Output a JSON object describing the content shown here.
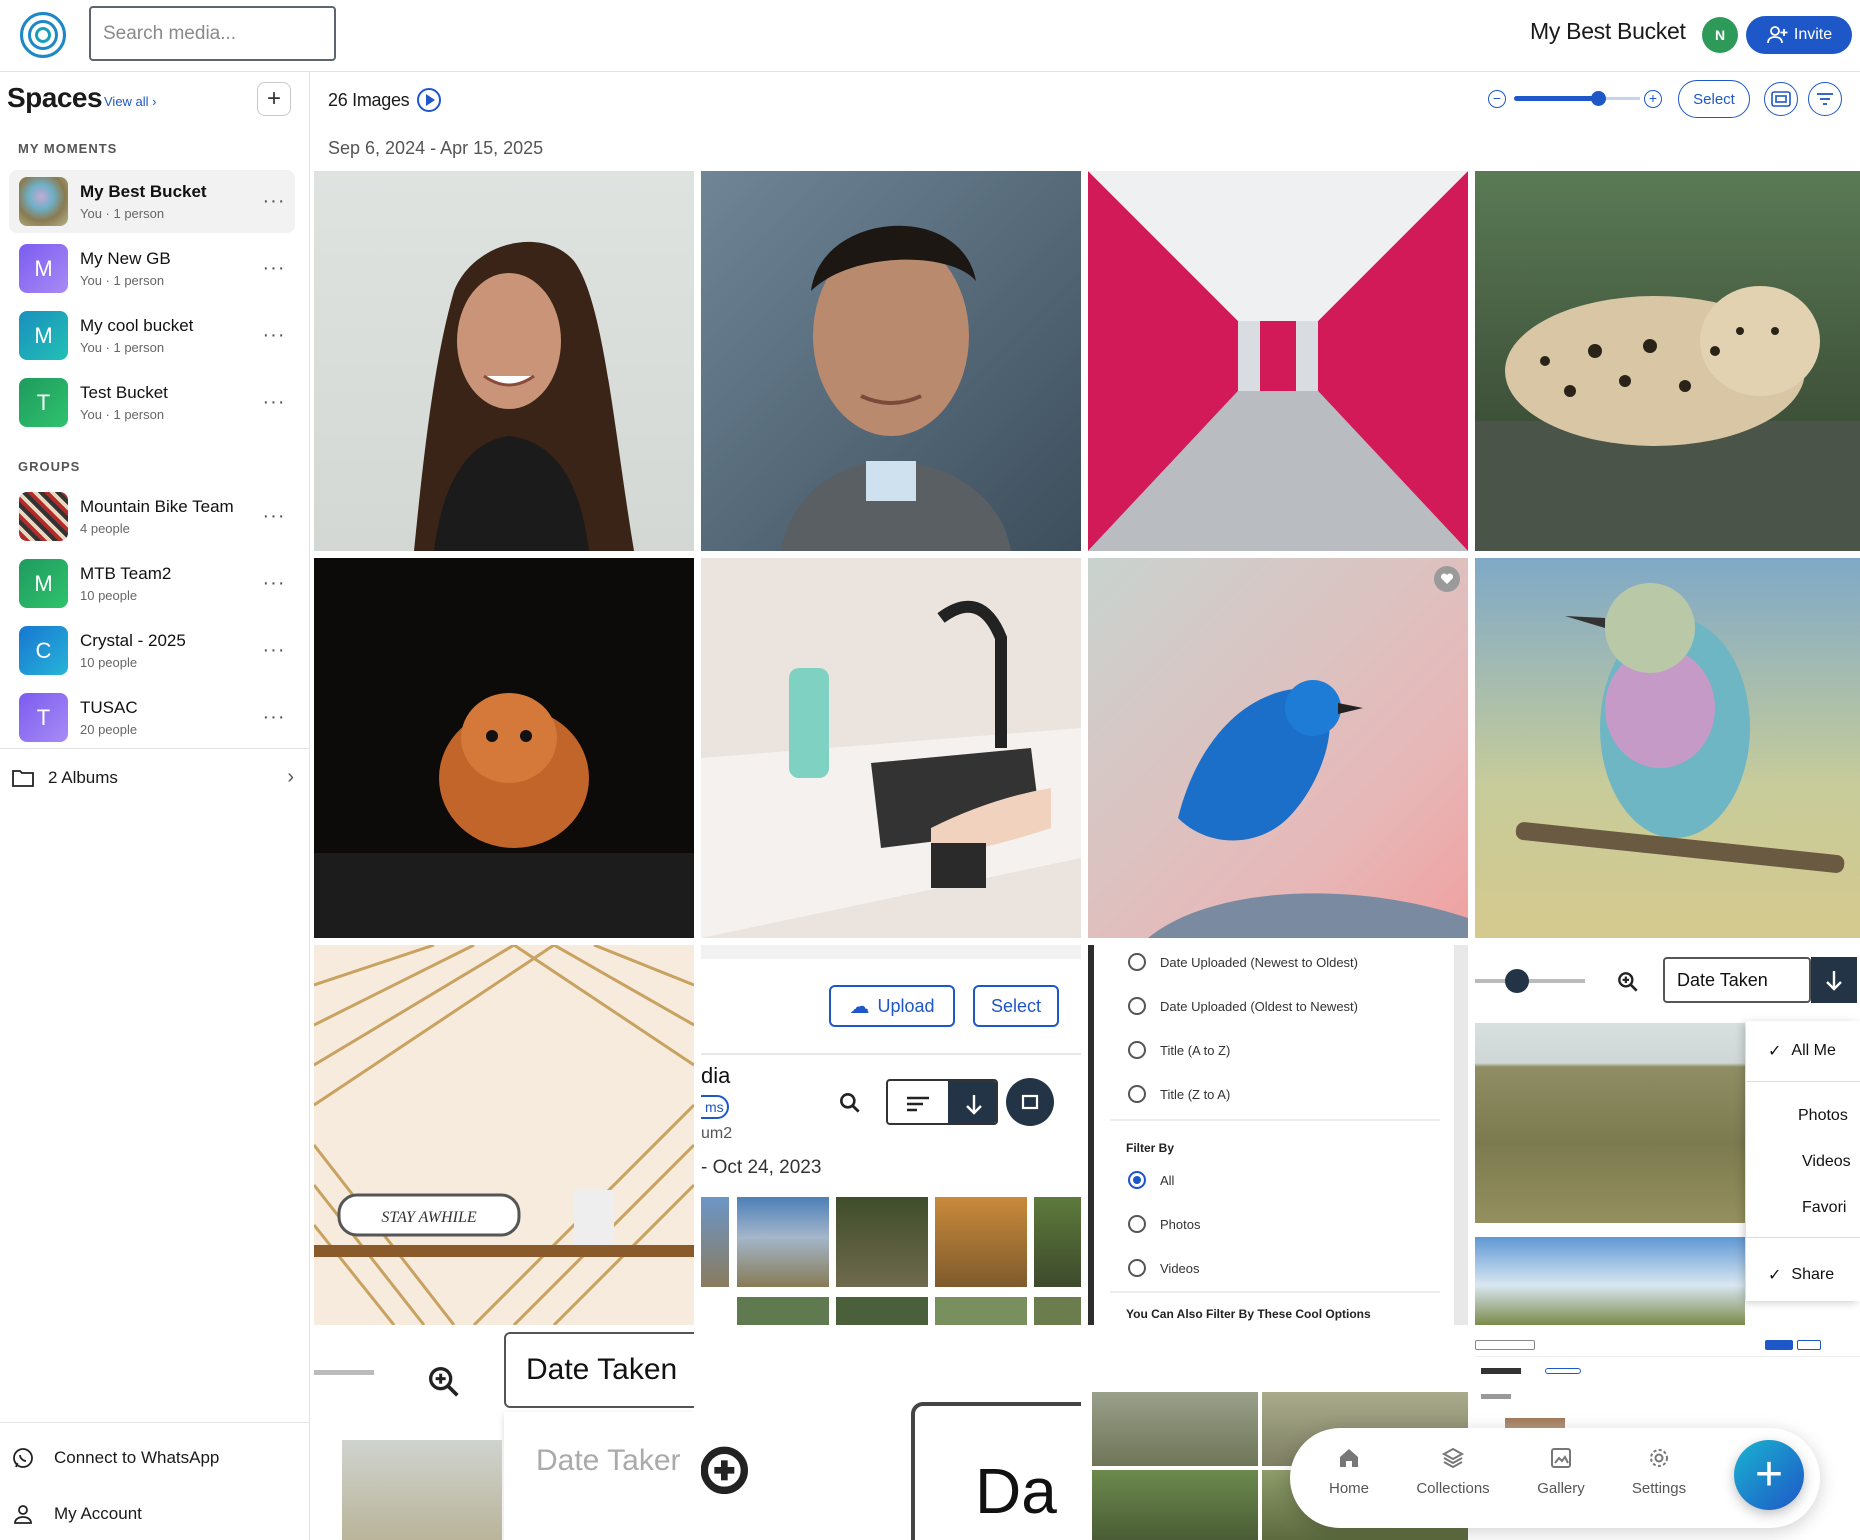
{
  "header": {
    "search_placeholder": "Search media...",
    "bucket_title": "My Best Bucket",
    "avatar_initial": "N",
    "invite_label": "Invite"
  },
  "sidebar": {
    "title": "Spaces",
    "view_all": "View all ›",
    "add_label": "+",
    "moments_label": "MY MOMENTS",
    "moments": [
      {
        "name": "My Best Bucket",
        "sub": "You · 1 person",
        "initial": ""
      },
      {
        "name": "My New GB",
        "sub": "You · 1 person",
        "initial": "M"
      },
      {
        "name": "My cool bucket",
        "sub": "You · 1 person",
        "initial": "M"
      },
      {
        "name": "Test Bucket",
        "sub": "You · 1 person",
        "initial": "T"
      }
    ],
    "groups_label": "GROUPS",
    "groups": [
      {
        "name": "Mountain Bike Team",
        "sub": "4 people",
        "initial": ""
      },
      {
        "name": "MTB Team2",
        "sub": "10 people",
        "initial": "M"
      },
      {
        "name": "Crystal - 2025",
        "sub": "10 people",
        "initial": "C"
      },
      {
        "name": "TUSAC",
        "sub": "20 people",
        "initial": "T"
      }
    ],
    "more_label": "···",
    "albums_label": "2 Albums",
    "whatsapp_label": "Connect to WhatsApp",
    "account_label": "My Account"
  },
  "content": {
    "count_label": "26 Images",
    "date_range": "Sep 6, 2024 - Apr 15, 2025",
    "select_label": "Select"
  },
  "screenshot_tiles": {
    "upload_label": "Upload",
    "select_label": "Select",
    "partial_title": "dia",
    "partial_chip": "ms",
    "partial_album": "um2",
    "partial_date": "- Oct 24, 2023",
    "sort_options": [
      "Date Uploaded (Newest to Oldest)",
      "Date Uploaded (Oldest to Newest)",
      "Title (A to Z)",
      "Title (Z to A)"
    ],
    "filter_by_label": "Filter By",
    "filter_options": [
      "All",
      "Photos",
      "Videos"
    ],
    "filter_footer": "You Can Also Filter By These Cool Options",
    "date_taken_label": "Date Taken",
    "media_menu": [
      "All Me",
      "Photos",
      "Videos",
      "Favori",
      "Share"
    ],
    "big_date_taken": "Date Taken",
    "faded_date_taken": "Date Taker",
    "big_partial": "Da"
  },
  "bottom_nav": {
    "items": [
      "Home",
      "Collections",
      "Gallery",
      "Settings"
    ],
    "fab_label": "+"
  },
  "colors": {
    "accent": "#1e57c7",
    "avatar_green": "#2e9a5a"
  }
}
